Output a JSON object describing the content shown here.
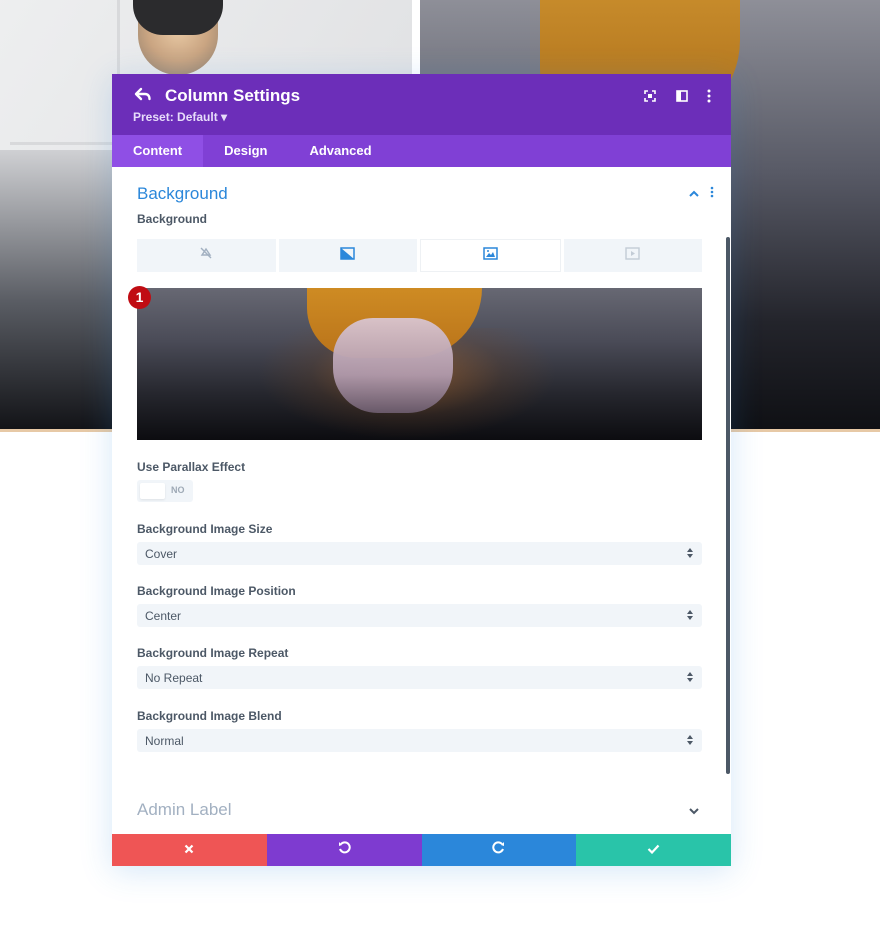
{
  "modal": {
    "title": "Column Settings",
    "preset": "Preset: Default ▾",
    "tabs": [
      "Content",
      "Design",
      "Advanced"
    ],
    "active_tab": "Content"
  },
  "background_section": {
    "title": "Background",
    "field_label": "Background",
    "type_tabs": [
      "no-background-icon",
      "gradient-icon",
      "image-icon",
      "video-icon"
    ],
    "active_type": "image-icon",
    "badge": "1"
  },
  "parallax": {
    "label": "Use Parallax Effect",
    "state": "NO"
  },
  "fields": [
    {
      "label": "Background Image Size",
      "value": "Cover"
    },
    {
      "label": "Background Image Position",
      "value": "Center"
    },
    {
      "label": "Background Image Repeat",
      "value": "No Repeat"
    },
    {
      "label": "Background Image Blend",
      "value": "Normal"
    }
  ],
  "admin_label": "Admin Label",
  "footer": [
    "close-icon",
    "undo-icon",
    "redo-icon",
    "check-icon"
  ],
  "colors": {
    "header": "#6c2eb9",
    "tabs": "#8040d5",
    "accent": "#2b87da",
    "cancel": "#ef5555",
    "undo": "#7e3bd0",
    "redo": "#2b87da",
    "save": "#29c4a9"
  }
}
